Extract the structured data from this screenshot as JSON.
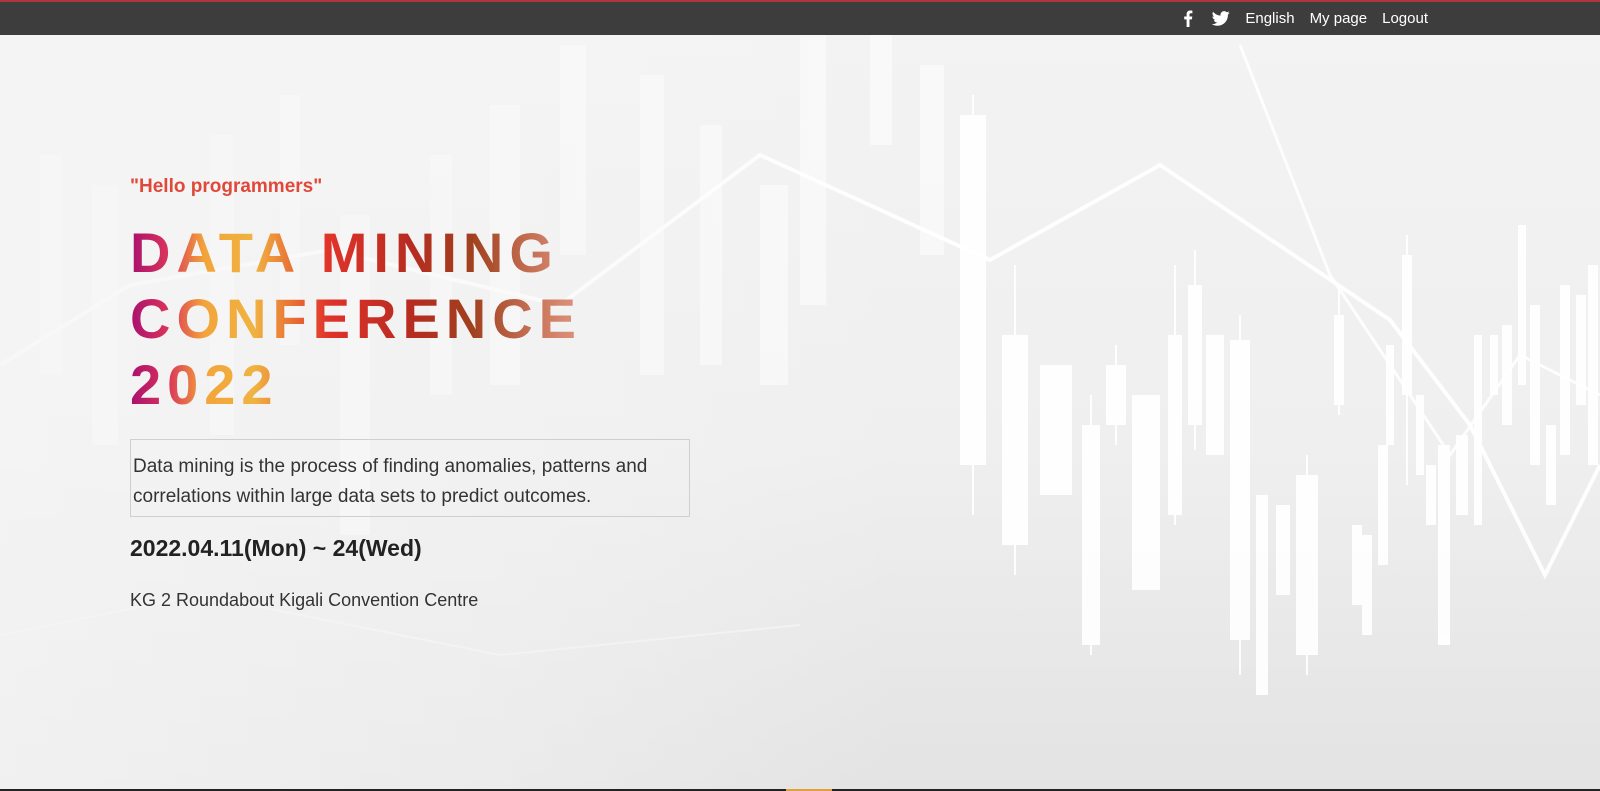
{
  "header": {
    "social": [
      {
        "icon": "facebook-icon"
      },
      {
        "icon": "twitter-icon"
      }
    ],
    "language_label": "English",
    "mypage_label": "My page",
    "logout_label": "Logout",
    "colors": {
      "bar": "#3d3d3d",
      "accent_line": "#b2343f"
    }
  },
  "hero": {
    "greeting": "\"Hello programmers\"",
    "title_lines": [
      "DATA MINING",
      "CONFERENCE",
      "2022"
    ],
    "description": "Data mining is the process of finding anomalies, patterns and correlations within large data sets to predict outcomes.",
    "dates": "2022.04.11(Mon) ~ 24(Wed)",
    "venue": "KG 2 Roundabout Kigali Convention Centre",
    "background": "candlestick-chart-image",
    "colors": {
      "greeting": "#e0493a",
      "text": "#333333"
    }
  }
}
